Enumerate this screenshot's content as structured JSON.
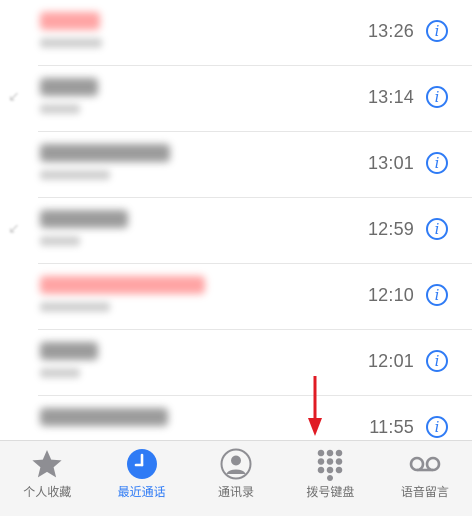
{
  "calls": [
    {
      "time": "13:26",
      "missed": true,
      "name_w": 60,
      "sub_w": 62
    },
    {
      "time": "13:14",
      "missed": false,
      "name_w": 58,
      "sub_w": 40
    },
    {
      "time": "13:01",
      "missed": false,
      "name_w": 130,
      "sub_w": 70
    },
    {
      "time": "12:59",
      "missed": false,
      "name_w": 88,
      "sub_w": 40
    },
    {
      "time": "12:10",
      "missed": true,
      "name_w": 165,
      "sub_w": 70
    },
    {
      "time": "12:01",
      "missed": false,
      "name_w": 58,
      "sub_w": 40
    },
    {
      "time": "11:55",
      "missed": false,
      "name_w": 128,
      "sub_w": 0
    }
  ],
  "tabs": [
    {
      "label": "个人收藏",
      "icon": "star-icon",
      "active": false
    },
    {
      "label": "最近通话",
      "icon": "clock-icon",
      "active": true
    },
    {
      "label": "通讯录",
      "icon": "contacts-icon",
      "active": false
    },
    {
      "label": "拨号键盘",
      "icon": "keypad-icon",
      "active": false
    },
    {
      "label": "语音留言",
      "icon": "voicemail-icon",
      "active": false
    }
  ],
  "colors": {
    "accent": "#2f7bf5",
    "missed": "#ff5a5a",
    "arrow": "#e01b24"
  }
}
